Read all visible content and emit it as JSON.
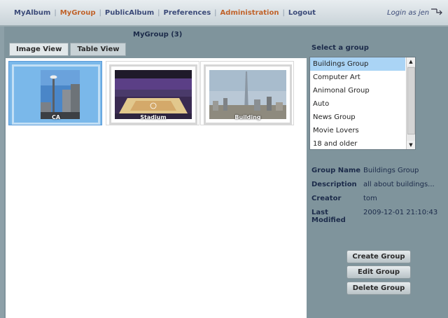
{
  "nav": {
    "items": [
      "MyAlbum",
      "MyGroup",
      "PublicAlbum",
      "Preferences",
      "Administration",
      "Logout"
    ],
    "separator": "|",
    "login_text": "Login as jen"
  },
  "main": {
    "group_title": "MyGroup (3)",
    "tabs": [
      "Image View",
      "Table View"
    ],
    "selected_tab": "Image View",
    "thumbnails": [
      {
        "caption": "CA",
        "selected": true
      },
      {
        "caption": "Stadium",
        "selected": false
      },
      {
        "caption": "Building",
        "selected": false
      }
    ]
  },
  "right": {
    "select_label": "Select a group",
    "groups": [
      "Buildings Group",
      "Computer Art",
      "Animonal Group",
      "Auto",
      "News Group",
      "Movie Lovers",
      "18 and older"
    ],
    "selected_group": "Buildings Group",
    "details": [
      {
        "key": "Group Name",
        "value": "Buildings Group"
      },
      {
        "key": "Description",
        "value": "all about buildings..."
      },
      {
        "key": "Creator",
        "value": "tom"
      },
      {
        "key": "Last Modified",
        "value": "2009-12-01 21:10:43"
      }
    ],
    "buttons": [
      "Create Group",
      "Edit Group",
      "Delete Group"
    ]
  },
  "colors": {
    "accent": "#c0622a",
    "nav_link": "#3b4a78",
    "selected_thumb": "#7ab8ea",
    "sidebar_bg": "#7f949c"
  }
}
